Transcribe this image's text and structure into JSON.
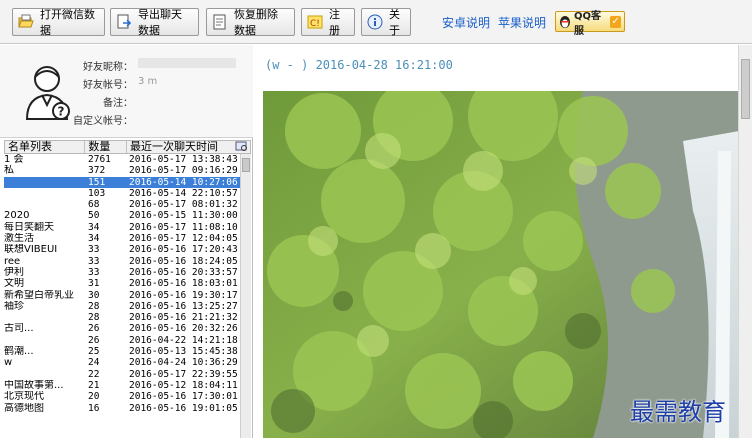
{
  "toolbar": {
    "buttons": [
      {
        "label": "打开微信数据",
        "icon": "folder-open-icon"
      },
      {
        "label": "导出聊天数据",
        "icon": "export-icon"
      },
      {
        "label": "恢复删除数据",
        "icon": "restore-icon"
      },
      {
        "label": "注 册",
        "icon": "register-icon"
      },
      {
        "label": "关于",
        "icon": "info-icon"
      }
    ],
    "links": [
      "安卓说明",
      "苹果说明"
    ],
    "qq_label": "QQ客服"
  },
  "profile": {
    "nickname_label": "好友昵称：",
    "account_label": "好友帐号：",
    "account_value": "3                        m",
    "remark_label": "备注：",
    "alias_label": "自定义帐号："
  },
  "list": {
    "headers": [
      "名单列表",
      "数量",
      "最近一次聊天时间"
    ],
    "rows": [
      {
        "name": "1      会",
        "count": "2761",
        "time": "2016-05-17  13:38:43"
      },
      {
        "name": "私",
        "count": "372",
        "time": "2016-05-17  09:16:29"
      },
      {
        "name": "",
        "count": "151",
        "time": "2016-05-14  10:27:06",
        "selected": true
      },
      {
        "name": "",
        "count": "103",
        "time": "2016-05-14  22:10:57"
      },
      {
        "name": "",
        "count": "68",
        "time": "2016-05-17  08:01:32"
      },
      {
        "name": "2020",
        "count": "50",
        "time": "2016-05-15  11:30:00"
      },
      {
        "name": "每日笑翻天",
        "count": "34",
        "time": "2016-05-17  11:08:10"
      },
      {
        "name": "   激生活",
        "count": "34",
        "time": "2016-05-17  12:04:05"
      },
      {
        "name": "联想VIBEUI",
        "count": "33",
        "time": "2016-05-16  17:20:43"
      },
      {
        "name": "       ree",
        "count": "33",
        "time": "2016-05-16  18:24:05"
      },
      {
        "name": "伊利",
        "count": "33",
        "time": "2016-05-16  20:33:57"
      },
      {
        "name": "文明",
        "count": "31",
        "time": "2016-05-16  18:03:01"
      },
      {
        "name": "新希望白帝乳业",
        "count": "30",
        "time": "2016-05-16  19:30:17"
      },
      {
        "name": "袖珍",
        "count": "28",
        "time": "2016-05-16  13:25:27"
      },
      {
        "name": "",
        "count": "28",
        "time": "2016-05-16  21:21:32"
      },
      {
        "name": "    古司...",
        "count": "26",
        "time": "2016-05-16  20:32:26"
      },
      {
        "name": "",
        "count": "26",
        "time": "2016-04-22  14:21:18"
      },
      {
        "name": "   鹤潮...",
        "count": "25",
        "time": "2016-05-13  15:45:38"
      },
      {
        "name": "      w",
        "count": "24",
        "time": "2016-04-24  10:36:29"
      },
      {
        "name": "",
        "count": "22",
        "time": "2016-05-17  22:39:55"
      },
      {
        "name": "中国故事第...",
        "count": "21",
        "time": "2016-05-12  18:04:11"
      },
      {
        "name": "北京现代",
        "count": "20",
        "time": "2016-05-16  17:30:01"
      },
      {
        "name": "高德地图",
        "count": "16",
        "time": "2016-05-16  19:01:05"
      }
    ]
  },
  "chat": {
    "header": "    (w           -  ) 2016-04-28 16:21:00"
  },
  "watermark": "最需教育",
  "colors": {
    "selected_row": "#3c7fd8",
    "link": "#1a5fc8",
    "chat_header": "#4c8fb8",
    "watermark": "#1e3fa8"
  }
}
